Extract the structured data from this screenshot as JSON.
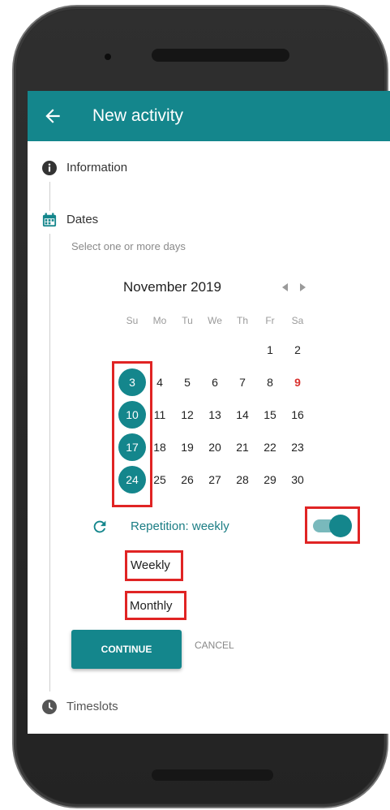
{
  "appbar": {
    "title": "New activity"
  },
  "steps": {
    "information": "Information",
    "dates": "Dates",
    "timeslots": "Timeslots"
  },
  "dates": {
    "hint": "Select one or more days"
  },
  "calendar": {
    "month": "November 2019",
    "weekdays": [
      "Su",
      "Mo",
      "Tu",
      "We",
      "Th",
      "Fr",
      "Sa"
    ],
    "rows": [
      [
        "",
        "",
        "",
        "",
        "",
        "1",
        "2"
      ],
      [
        "3",
        "4",
        "5",
        "6",
        "7",
        "8",
        "9"
      ],
      [
        "10",
        "11",
        "12",
        "13",
        "14",
        "15",
        "16"
      ],
      [
        "17",
        "18",
        "19",
        "20",
        "21",
        "22",
        "23"
      ],
      [
        "24",
        "25",
        "26",
        "27",
        "28",
        "29",
        "30"
      ]
    ],
    "selected": [
      "3",
      "10",
      "17",
      "24"
    ],
    "today": "9"
  },
  "repetition": {
    "label": "Repetition: weekly",
    "enabled": true
  },
  "options": {
    "weekly": "Weekly",
    "monthly": "Monthly"
  },
  "actions": {
    "continue": "CONTINUE",
    "cancel": "CANCEL"
  },
  "colors": {
    "accent": "#14868c",
    "highlight": "#e02424",
    "today": "#d9322f"
  }
}
